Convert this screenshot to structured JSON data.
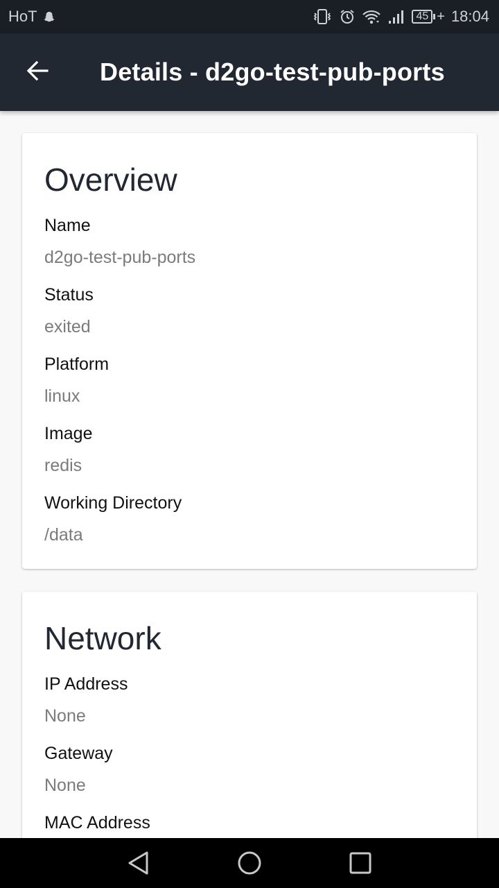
{
  "status_bar": {
    "carrier": "HoT",
    "notification_icon": "snapchat-ghost-icon",
    "icons": [
      "vibrate-icon",
      "alarm-icon",
      "wifi-icon",
      "signal-icon"
    ],
    "battery_level": "45",
    "charging": true,
    "time": "18:04"
  },
  "app_bar": {
    "back_icon": "arrow-left-icon",
    "title": "Details - d2go-test-pub-ports"
  },
  "overview": {
    "title": "Overview",
    "fields": [
      {
        "label": "Name",
        "value": "d2go-test-pub-ports"
      },
      {
        "label": "Status",
        "value": "exited"
      },
      {
        "label": "Platform",
        "value": "linux"
      },
      {
        "label": "Image",
        "value": "redis"
      },
      {
        "label": "Working Directory",
        "value": "/data"
      }
    ]
  },
  "network": {
    "title": "Network",
    "fields": [
      {
        "label": "IP Address",
        "value": "None"
      },
      {
        "label": "Gateway",
        "value": "None"
      },
      {
        "label": "MAC Address",
        "value": ""
      }
    ]
  },
  "nav_bar": {
    "buttons": [
      "back-triangle-icon",
      "home-circle-icon",
      "recents-square-icon"
    ]
  },
  "colors": {
    "status_bar_bg": "#1a1e25",
    "app_bar_bg": "#222831",
    "page_bg": "#f8f8f8",
    "card_bg": "#ffffff",
    "label_color": "#111111",
    "value_color": "#7b7b7b"
  }
}
